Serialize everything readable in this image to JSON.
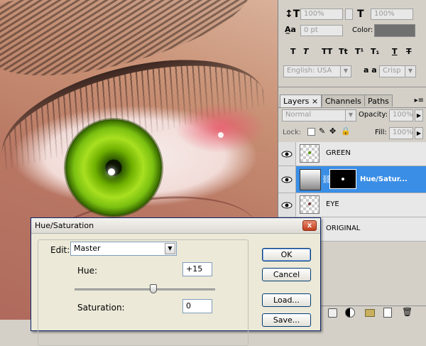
{
  "character_panel": {
    "leading_value": "100%",
    "tracking_value": "100%",
    "baseline_value": "0 pt",
    "color_label": "Color:",
    "language": "English: USA",
    "antialias_label": "a a",
    "antialias_value": "Crisp",
    "style_buttons": [
      "T",
      "T",
      "TT",
      "Tt",
      "T¹",
      "T₁",
      "T",
      "T"
    ],
    "colors": {
      "color_swatch": "#707070"
    }
  },
  "layers_panel": {
    "tabs": [
      {
        "label": "Layers"
      },
      {
        "label": "Channels"
      },
      {
        "label": "Paths"
      }
    ],
    "close_glyph": "×",
    "blend_mode": "Normal",
    "opacity_label": "Opacity:",
    "opacity_value": "100%",
    "lock_label": "Lock:",
    "fill_label": "Fill:",
    "fill_value": "100%",
    "layers": [
      {
        "name": "GREEN",
        "selected": false
      },
      {
        "name": "Hue/Satur...",
        "selected": true
      },
      {
        "name": "EYE",
        "selected": false
      },
      {
        "name": "ORIGINAL",
        "selected": false
      }
    ],
    "colors": {
      "selection": "#3a8ee6"
    }
  },
  "dialog": {
    "title": "Hue/Saturation",
    "close_glyph": "x",
    "edit_label": "Edit:",
    "edit_value": "Master",
    "hue_label": "Hue:",
    "hue_value": "+15",
    "hue_slider_fraction": 0.56,
    "saturation_label": "Saturation:",
    "saturation_value": "0",
    "buttons": {
      "ok": "OK",
      "cancel": "Cancel",
      "load": "Load...",
      "save": "Save..."
    }
  }
}
